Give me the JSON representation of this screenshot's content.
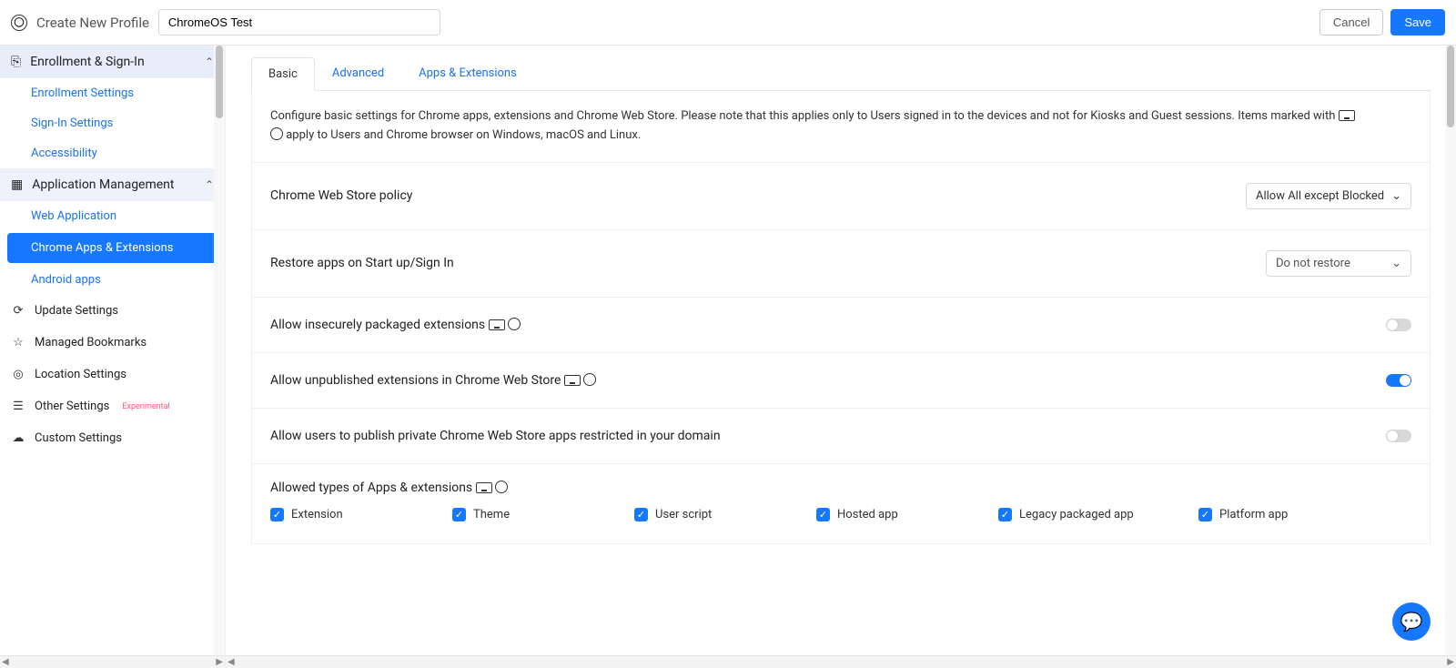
{
  "header": {
    "title": "Create New Profile",
    "input_value": "ChromeOS Test",
    "cancel": "Cancel",
    "save": "Save"
  },
  "sidebar": {
    "enrollment": {
      "label": "Enrollment & Sign-In",
      "items": [
        "Enrollment Settings",
        "Sign-In Settings",
        "Accessibility"
      ]
    },
    "apps": {
      "label": "Application Management",
      "items": [
        "Web Application",
        "Chrome Apps & Extensions",
        "Android apps"
      ],
      "active_index": 1
    },
    "flat_items": [
      "Update Settings",
      "Managed Bookmarks",
      "Location Settings",
      "Other Settings",
      "Custom Settings"
    ],
    "experimental_tag": "Experimental"
  },
  "tabs": [
    "Basic",
    "Advanced",
    "Apps & Extensions"
  ],
  "active_tab": 0,
  "description": {
    "line1_a": "Configure basic settings for Chrome apps, extensions and Chrome Web Store. Please note that this applies only to Users signed in to the devices and not for Kiosks and Guest sessions. Items marked with ",
    "line2": " apply to Users and Chrome browser on Windows, macOS and Linux."
  },
  "rows": {
    "cws_policy": {
      "label": "Chrome Web Store policy",
      "value": "Allow All except Blocked"
    },
    "restore": {
      "label": "Restore apps on Start up/Sign In",
      "value": "Do not restore"
    },
    "insecure": {
      "label": "Allow insecurely packaged extensions",
      "on": false
    },
    "unpublished": {
      "label": "Allow unpublished extensions in Chrome Web Store",
      "on": true
    },
    "publish_private": {
      "label": "Allow users to publish private Chrome Web Store apps restricted in your domain",
      "on": false
    },
    "allowed_types": {
      "label": "Allowed types of Apps & extensions",
      "items": [
        "Extension",
        "Theme",
        "User script",
        "Hosted app",
        "Legacy packaged app",
        "Platform app"
      ]
    }
  }
}
